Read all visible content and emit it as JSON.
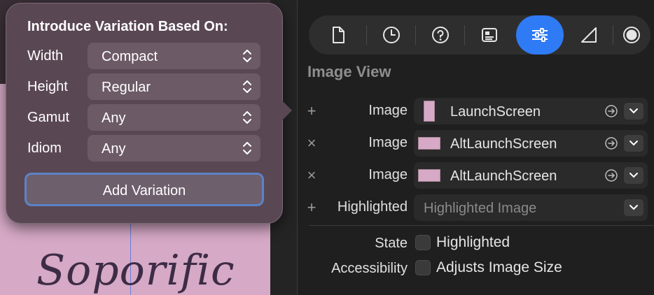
{
  "canvas": {
    "preview_text": "Soporific"
  },
  "popover": {
    "title": "Introduce Variation Based On:",
    "rows": [
      {
        "label": "Width",
        "value": "Compact"
      },
      {
        "label": "Height",
        "value": "Regular"
      },
      {
        "label": "Gamut",
        "value": "Any"
      },
      {
        "label": "Idiom",
        "value": "Any"
      }
    ],
    "button_label": "Add Variation"
  },
  "inspector": {
    "tabs": [
      {
        "icon": "file-icon"
      },
      {
        "icon": "clock-icon"
      },
      {
        "icon": "help-icon"
      },
      {
        "icon": "identity-icon"
      },
      {
        "icon": "attributes-icon",
        "active": true
      },
      {
        "icon": "size-icon"
      },
      {
        "icon": "connections-icon"
      }
    ],
    "section_title": "Image View",
    "image_rows": [
      {
        "prefix": "+",
        "label": "Image",
        "value": "LaunchScreen"
      },
      {
        "prefix": "×",
        "label": "Image",
        "value": "AltLaunchScreen"
      },
      {
        "prefix": "×",
        "label": "Image",
        "value": "AltLaunchScreen"
      },
      {
        "prefix": "+",
        "label": "Highlighted",
        "value": "Highlighted Image"
      }
    ],
    "state": {
      "label": "State",
      "checkbox_label": "Highlighted",
      "checked": false
    },
    "accessibility": {
      "label": "Accessibility",
      "checkbox_label": "Adjusts Image Size",
      "checked": false
    }
  },
  "colors": {
    "accent": "#2f7bf5",
    "preview_background": "#d6a9c6",
    "popover_background": "#5a4754",
    "button_focus_ring": "#5c83c6"
  }
}
